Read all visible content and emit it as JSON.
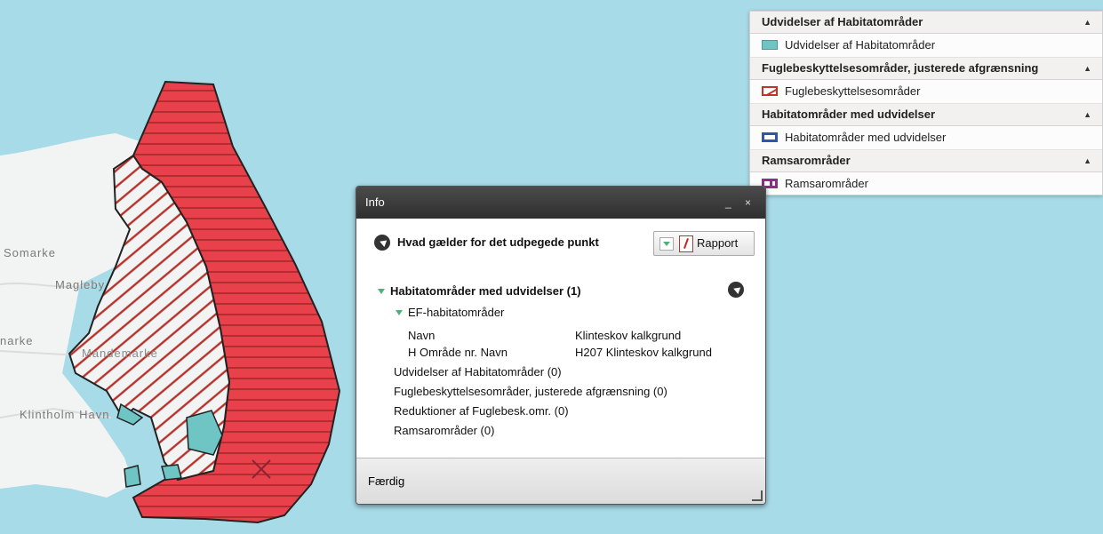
{
  "colors": {
    "sea": "#a8dbe8",
    "land": "#f2f4f3",
    "protected_fill": "#e9414c",
    "hatch": "#b5332c",
    "teal": "#6fc4c4"
  },
  "map": {
    "labels": [
      "Somarke",
      "Magleby",
      "narke",
      "Mandemarke",
      "Klintholm Havn"
    ],
    "marker_icon": "x-marker-icon"
  },
  "legend": {
    "sections": [
      {
        "title": "Udvidelser af Habitatområder",
        "collapse_icon": "triangle-up-icon",
        "item": {
          "symbol": "teal-fill",
          "label": "Udvidelser af Habitatområder"
        }
      },
      {
        "title": "Fuglebeskyttelsesområder, justerede afgrænsning",
        "collapse_icon": "triangle-up-icon",
        "item": {
          "symbol": "red-hatch",
          "label": "Fuglebeskyttelsesområder"
        }
      },
      {
        "title": "Habitatområder med udvidelser",
        "collapse_icon": "triangle-up-icon",
        "item": {
          "symbol": "blue-outline",
          "label": "Habitatområder med udvidelser"
        }
      },
      {
        "title": "Ramsarområder",
        "collapse_icon": "triangle-up-icon",
        "item": {
          "symbol": "purple-outline",
          "label": "Ramsarområder"
        }
      }
    ]
  },
  "info": {
    "title": "Info",
    "controls": "_ ×",
    "heading": "Hvad gælder for det udpegede punkt",
    "report_label": "Rapport",
    "group": {
      "label": "Habitatområder med udvidelser (1)",
      "sub_label": "EF-habitatområder",
      "rows": [
        {
          "key": "Navn",
          "value": "Klinteskov kalkgrund"
        },
        {
          "key": "H Område nr. Navn",
          "value": "H207 Klinteskov kalkgrund"
        }
      ]
    },
    "other_layers": [
      "Udvidelser af Habitatområder (0)",
      "Fuglebeskyttelsesområder, justerede afgrænsning (0)",
      "Reduktioner af Fuglebesk.omr. (0)",
      "Ramsarområder (0)"
    ],
    "footer": "Færdig"
  }
}
